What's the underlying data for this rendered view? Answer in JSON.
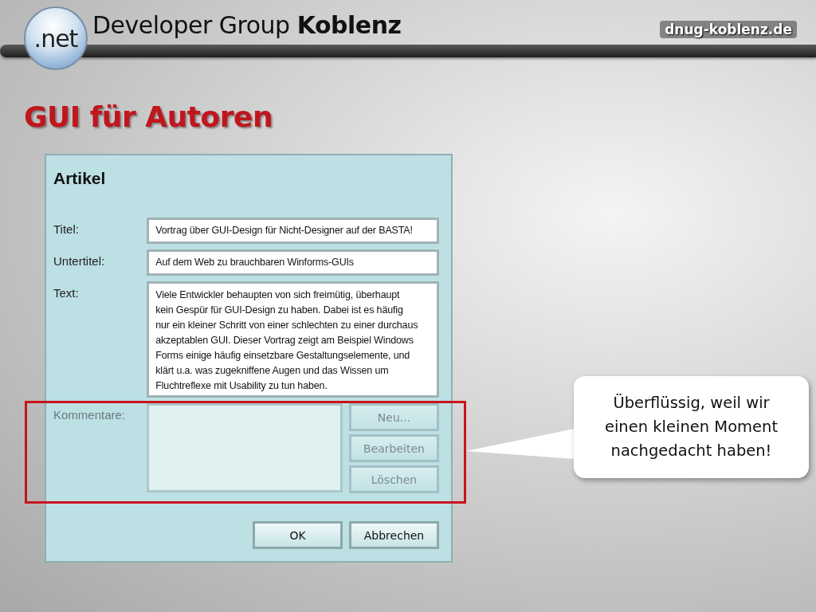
{
  "header": {
    "logo_text": ".net",
    "title_regular": "Developer Group",
    "title_bold": "Koblenz",
    "url": "dnug-koblenz.de"
  },
  "slide_title": "GUI für Autoren",
  "dialog": {
    "title": "Artikel",
    "fields": [
      {
        "label": "Titel:",
        "kind": "line",
        "value": "Vortrag über GUI-Design für Nicht-Designer auf der BASTA!"
      },
      {
        "label": "Untertitel:",
        "kind": "line",
        "value": "Auf dem Web zu brauchbaren Winforms-GUIs"
      },
      {
        "label": "Text:",
        "kind": "multiline",
        "value": "Viele Entwickler behaupten von sich freimütig, überhaupt kein Gespür für GUI-Design zu haben. Dabei ist es häufig nur ein kleiner Schritt von einer schlechten zu einer durchaus akzeptablen GUI. Dieser Vortrag zeigt am Beispiel Windows Forms einige häufig einsetzbare Gestaltungselemente, und klärt u.a. was zugekniffene Augen und das Wissen um Fluchtreflexe mit Usability zu tun haben."
      }
    ],
    "comments": {
      "label": "Kommentare:",
      "dimmed": true,
      "buttons": [
        "Neu...",
        "Bearbeiten",
        "Löschen"
      ]
    },
    "buttons": [
      "OK",
      "Abbrechen"
    ]
  },
  "callout": {
    "text": "Überflüssig, weil wir einen kleinen Moment nachgedacht haben!"
  }
}
